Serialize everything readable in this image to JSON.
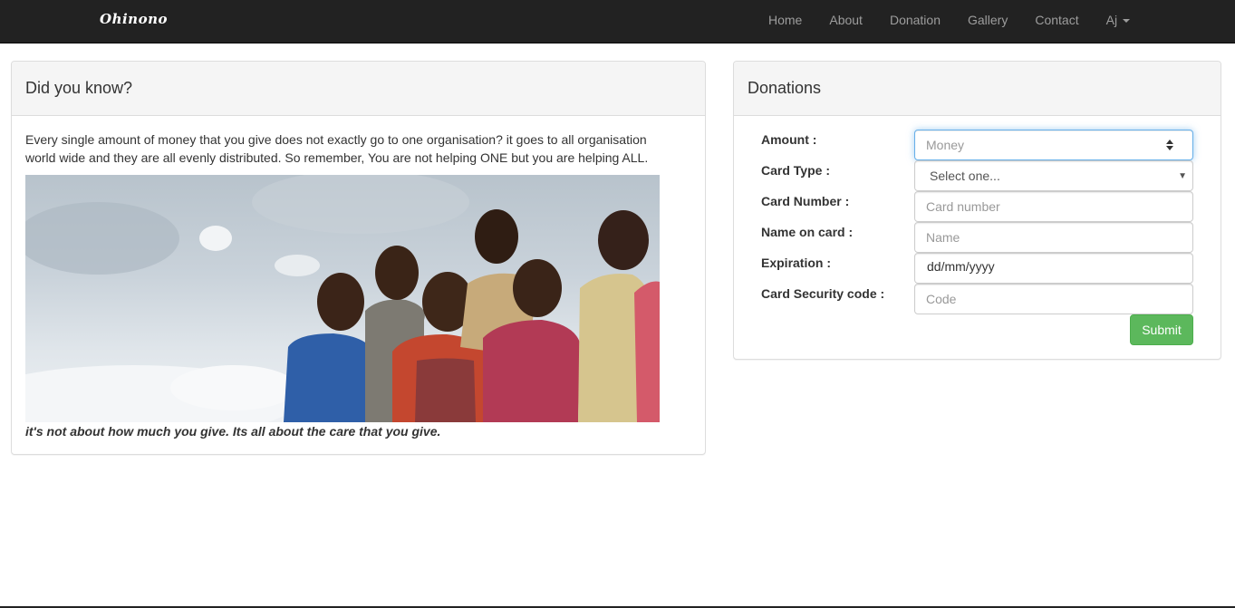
{
  "navbar": {
    "brand": "Ohinono",
    "links": [
      "Home",
      "About",
      "Donation",
      "Gallery",
      "Contact"
    ],
    "user_menu": "Aj"
  },
  "info_panel": {
    "title": "Did you know?",
    "text": "Every single amount of money that you give does not exactly go to one organisation? it goes to all organisation world wide and they are all evenly distributed. So remember, You are not helping ONE but you are helping ALL.",
    "quote": "it's not about how much you give. Its all about the care that you give."
  },
  "donation_panel": {
    "title": "Donations",
    "fields": {
      "amount": {
        "label": "Amount :",
        "placeholder": "Money"
      },
      "card_type": {
        "label": "Card Type :",
        "value": "Select one..."
      },
      "card_number": {
        "label": "Card Number :",
        "placeholder": "Card number"
      },
      "name": {
        "label": "Name on card :",
        "placeholder": "Name"
      },
      "expiration": {
        "label": "Expiration :",
        "value": "dd/mm/yyyy"
      },
      "security": {
        "label": "Card Security code :",
        "placeholder": "Code"
      }
    },
    "submit_label": "Submit"
  },
  "colors": {
    "navbar_bg": "#222222",
    "submit_bg": "#5cb85c",
    "focus_border": "#66afe9"
  }
}
